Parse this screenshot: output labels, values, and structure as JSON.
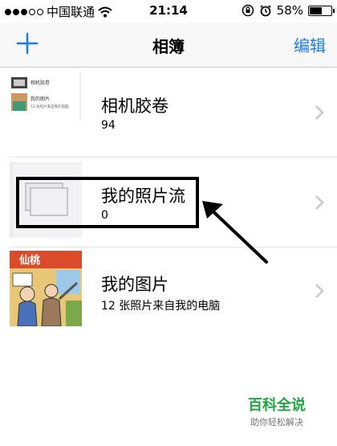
{
  "status_bar": {
    "carrier": "中国联通",
    "time": "21:14",
    "battery": "58%",
    "battery_level": 0.58,
    "signal_bars_filled": 3,
    "signal_bars_total": 5
  },
  "nav": {
    "title": "相簿",
    "edit_label": "编辑",
    "add_icon": "plus-icon"
  },
  "albums": [
    {
      "name": "相机胶卷",
      "count": "94",
      "mini_labels": [
        "相机胶卷",
        "我的图片",
        "12 张照片来自我的电脑"
      ]
    },
    {
      "name": "我的照片流",
      "count": "0"
    },
    {
      "name": "我的图片",
      "count": "12 张照片来自我的电脑",
      "thumb_text": "仙桃"
    }
  ],
  "watermark": {
    "title": "百科全说",
    "subtitle": "助你轻松解决"
  },
  "colors": {
    "accent": "#1a7cf2",
    "watermark": "#1fa541"
  }
}
